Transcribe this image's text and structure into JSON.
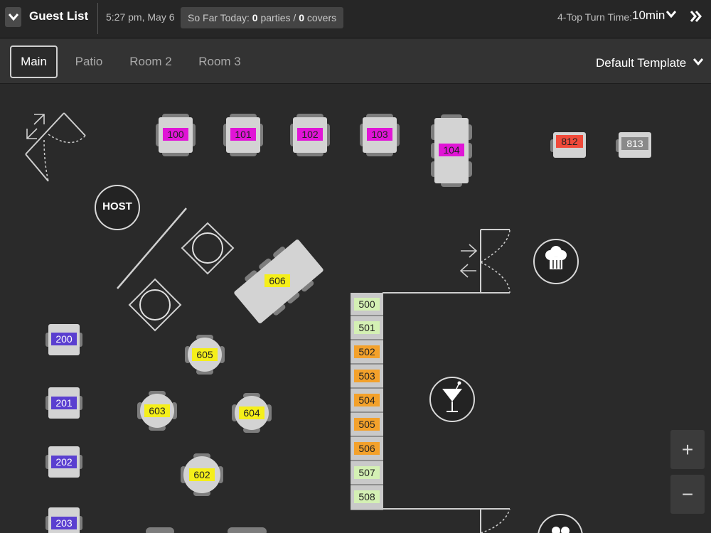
{
  "header": {
    "title": "Guest List",
    "datetime": "5:27 pm, May 6",
    "stats_label": "So Far Today:",
    "parties_count": "0",
    "parties_label": "parties",
    "separator": "/",
    "covers_count": "0",
    "covers_label": "covers",
    "turn_time_label": "4-Top Turn Time:",
    "turn_time_value": "10min"
  },
  "tabs": [
    {
      "label": "Main",
      "active": true
    },
    {
      "label": "Patio",
      "active": false
    },
    {
      "label": "Room 2",
      "active": false
    },
    {
      "label": "Room 3",
      "active": false
    }
  ],
  "template": {
    "label": "Default Template"
  },
  "floor": {
    "host_label": "HOST",
    "tables": {
      "t100": "100",
      "t101": "101",
      "t102": "102",
      "t103": "103",
      "t104": "104",
      "t812": "812",
      "t813": "813",
      "t606": "606",
      "t605": "605",
      "t603": "603",
      "t604": "604",
      "t602": "602",
      "t200": "200",
      "t201": "201",
      "t202": "202",
      "t203": "203",
      "t500": "500",
      "t501": "501",
      "t502": "502",
      "t503": "503",
      "t504": "504",
      "t505": "505",
      "t506": "506",
      "t507": "507",
      "t508": "508"
    }
  },
  "zoom": {
    "in_label": "+",
    "out_label": "−"
  },
  "colors": {
    "magenta": "#e015d6",
    "red": "#f04a3a",
    "gray_tag": "#8a8a8a",
    "yellow": "#f5ef1a",
    "blue": "#5a3fd0",
    "green": "#d4f0b4",
    "orange": "#f3a12b",
    "table": "#d3d3d3",
    "chair": "#7d7d7d"
  }
}
